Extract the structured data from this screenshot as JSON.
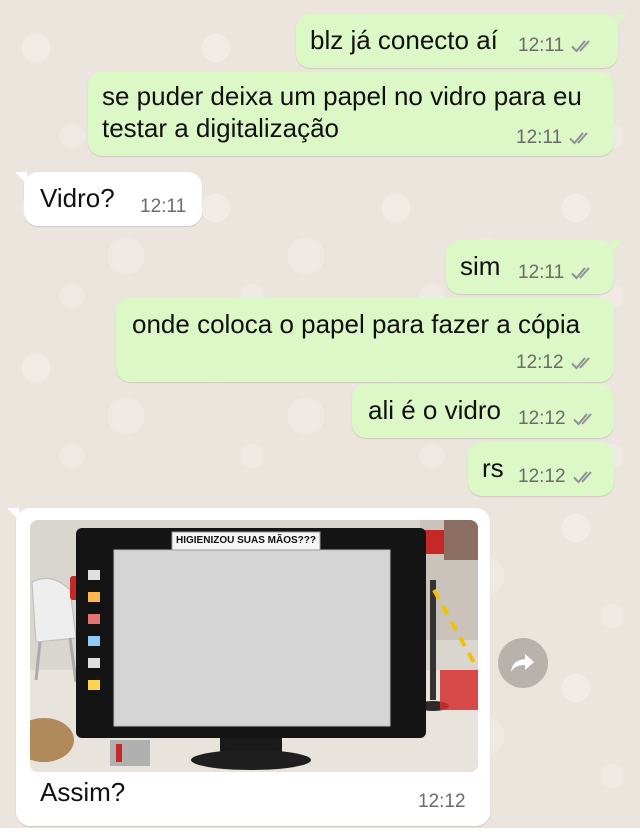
{
  "messages": [
    {
      "text": "blz já conecto aí",
      "time": "12:11",
      "direction": "out",
      "status": "read"
    },
    {
      "text_lines": [
        "se puder deixa um papel no vidro para eu",
        "testar a digitalização"
      ],
      "time": "12:11",
      "direction": "out",
      "status": "read"
    },
    {
      "text": "Vidro?",
      "time": "12:11",
      "direction": "in"
    },
    {
      "text": "sim",
      "time": "12:11",
      "direction": "out",
      "status": "read"
    },
    {
      "text": "onde coloca o papel para fazer a cópia",
      "time": "12:12",
      "direction": "out",
      "status": "read"
    },
    {
      "text": "ali é o vidro",
      "time": "12:12",
      "direction": "out",
      "status": "read"
    },
    {
      "text": "rs",
      "time": "12:12",
      "direction": "out",
      "status": "read"
    },
    {
      "type": "image",
      "caption": "Assim?",
      "time": "12:12",
      "direction": "in",
      "image_sign_text": "HIGIENIZOU SUAS MÃOS???"
    }
  ],
  "icons": {
    "ticks": "double-check-icon",
    "forward": "forward-arrow-icon"
  },
  "colors": {
    "outgoing": "#DCF8C6",
    "incoming": "#FFFFFF",
    "background": "#ECE5DD",
    "ticks": "#8e9196",
    "meta": "#6b6b6b"
  }
}
